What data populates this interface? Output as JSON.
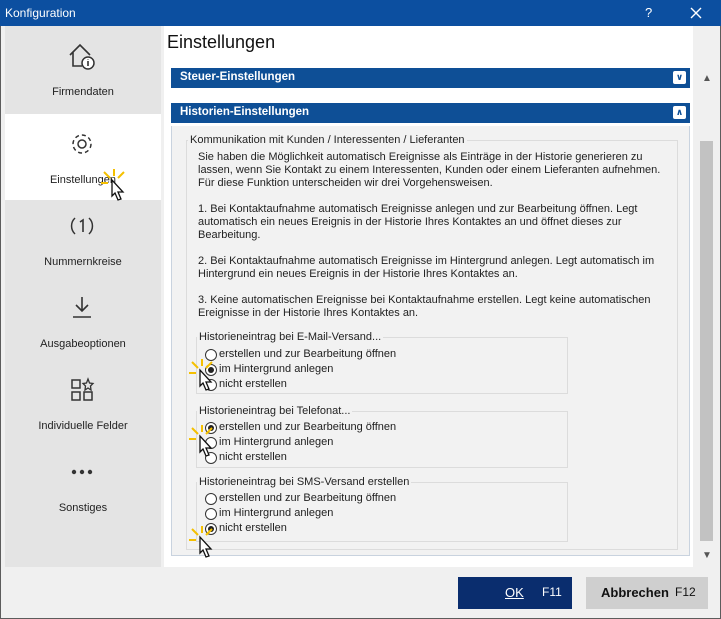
{
  "window": {
    "title": "Konfiguration",
    "help": "?"
  },
  "sidebar": {
    "items": [
      {
        "label": "Firmendaten",
        "icon": "home-info-icon"
      },
      {
        "label": "Einstellungen",
        "icon": "gear-icon",
        "active": true
      },
      {
        "label": "Nummernkreise",
        "icon": "number-cycle-icon"
      },
      {
        "label": "Ausgabeoptionen",
        "icon": "download-icon"
      },
      {
        "label": "Individuelle Felder",
        "icon": "custom-fields-icon"
      },
      {
        "label": "Sonstiges",
        "icon": "more-dots-icon"
      }
    ]
  },
  "main": {
    "title": "Einstellungen",
    "sections": [
      {
        "title": "Steuer-Einstellungen",
        "state": "collapsed"
      },
      {
        "title": "Historien-Einstellungen",
        "state": "expanded"
      }
    ],
    "group_title": "Kommunikation mit Kunden / Interessenten / Lieferanten",
    "paragraphs": [
      "Sie haben die Möglichkeit automatisch Ereignisse als Einträge in der Historie generieren zu lassen, wenn Sie Kontakt zu einem Interessenten, Kunden oder einem Lieferanten aufnehmen. Für diese Funktion unterscheiden wir drei Vorgehensweisen.",
      "1. Bei Kontaktaufnahme automatisch Ereignisse anlegen und zur Bearbeitung öffnen. Legt automatisch ein neues Ereignis in der Historie Ihres Kontaktes an und öffnet dieses zur Bearbeitung.",
      "2. Bei Kontaktaufnahme automatisch Ereignisse im Hintergrund anlegen. Legt automatisch im Hintergrund ein neues Ereignis in der Historie Ihres Kontaktes an.",
      "3. Keine automatischen Ereignisse bei Kontaktaufnahme erstellen. Legt keine automatischen Ereignisse in der Historie Ihres Kontaktes an."
    ],
    "groups": [
      {
        "title": "Historieneintrag bei E-Mail-Versand...",
        "selected": 1,
        "options": [
          "erstellen und zur Bearbeitung öffnen",
          "im Hintergrund anlegen",
          "nicht erstellen"
        ]
      },
      {
        "title": "Historieneintrag bei Telefonat...",
        "selected": 0,
        "options": [
          "erstellen und zur Bearbeitung öffnen",
          "im Hintergrund anlegen",
          "nicht erstellen"
        ]
      },
      {
        "title": "Historieneintrag bei SMS-Versand erstellen",
        "selected": 2,
        "options": [
          "erstellen und zur Bearbeitung öffnen",
          "im Hintergrund anlegen",
          "nicht erstellen"
        ]
      }
    ]
  },
  "footer": {
    "ok_label": "OK",
    "ok_key": "F11",
    "cancel_label": "Abbrechen",
    "cancel_key": "F12"
  },
  "colors": {
    "titlebar": "#0c4fa0",
    "section_bar": "#0e4f96",
    "ok_button": "#0a2d6e",
    "cursor_highlight": "#f5c000"
  }
}
